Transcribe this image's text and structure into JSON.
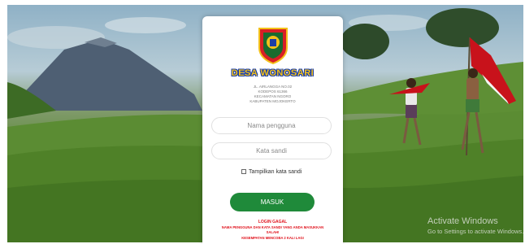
{
  "village": {
    "name": "DESA WONOSARI",
    "address_lines": [
      "JL. AIRLANGGA NO.02",
      "KODEPOS 61366",
      "KECAMATAN NGORO",
      "KABUPATEN MOJOKERTO"
    ]
  },
  "form": {
    "username_placeholder": "Nama pengguna",
    "password_placeholder": "Kata sandi",
    "show_password_label": "Tampilkan kata sandi",
    "submit_label": "MASUK"
  },
  "error": {
    "title": "LOGIN GAGAL",
    "line1": "NAMA PENGGUNA DAN KATA SANDI YANG ANDA MASUKKAN",
    "line2": "SALAH!",
    "line3": "KESEMPATAN MENCOBA 2 KALI LAGI"
  },
  "watermark": {
    "title": "Activate Windows",
    "subtitle": "Go to Settings to activate Windows."
  },
  "colors": {
    "button": "#1f8a3a",
    "title_fill": "#f3c11a",
    "title_outline": "#1b3ea6",
    "error": "#e0101a"
  }
}
